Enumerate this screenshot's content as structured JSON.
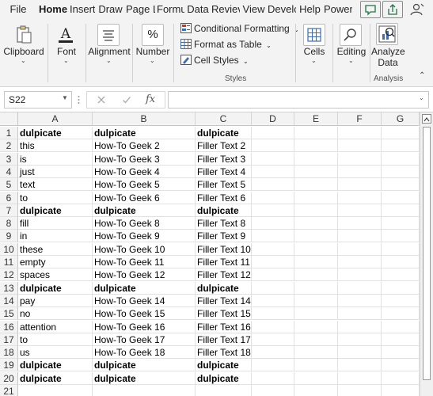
{
  "tabs": [
    "File",
    "Home",
    "Insert",
    "Draw",
    "Page L",
    "Formu",
    "Data",
    "Reviev",
    "View",
    "Develc",
    "Help",
    "Power"
  ],
  "active_tab": "Home",
  "ribbon": {
    "clipboard": "Clipboard",
    "font": "Font",
    "alignment": "Alignment",
    "number": "Number",
    "conditional_formatting": "Conditional Formatting",
    "format_as_table": "Format as Table",
    "cell_styles": "Cell Styles",
    "styles_group": "Styles",
    "cells": "Cells",
    "editing": "Editing",
    "analyze_line1": "Analyze",
    "analyze_line2": "Data",
    "analysis_group": "Analysis",
    "percent_glyph": "%",
    "font_glyph": "A"
  },
  "formula_bar": {
    "name_box": "S22",
    "fx": "fx",
    "formula": ""
  },
  "columns": [
    "A",
    "B",
    "C",
    "D",
    "E",
    "F",
    "G"
  ],
  "rows": [
    {
      "n": "1",
      "a": "dulpicate",
      "b": "dulpicate",
      "c": "dulpicate",
      "bold": true
    },
    {
      "n": "2",
      "a": "this",
      "b": "How-To Geek  2",
      "c": "Filler Text 2",
      "bold": false
    },
    {
      "n": "3",
      "a": "is",
      "b": "How-To Geek  3",
      "c": "Filler Text 3",
      "bold": false
    },
    {
      "n": "4",
      "a": "just",
      "b": "How-To Geek  4",
      "c": "Filler Text 4",
      "bold": false
    },
    {
      "n": "5",
      "a": "text",
      "b": "How-To Geek  5",
      "c": "Filler Text 5",
      "bold": false
    },
    {
      "n": "6",
      "a": "to",
      "b": "How-To Geek  6",
      "c": "Filler Text 6",
      "bold": false
    },
    {
      "n": "7",
      "a": "dulpicate",
      "b": "dulpicate",
      "c": "dulpicate",
      "bold": true
    },
    {
      "n": "8",
      "a": "fill",
      "b": "How-To Geek  8",
      "c": "Filler Text 8",
      "bold": false
    },
    {
      "n": "9",
      "a": "in",
      "b": "How-To Geek  9",
      "c": "Filler Text 9",
      "bold": false
    },
    {
      "n": "10",
      "a": "these",
      "b": "How-To Geek  10",
      "c": "Filler Text 10",
      "bold": false
    },
    {
      "n": "11",
      "a": "empty",
      "b": "How-To Geek  11",
      "c": "Filler Text 11",
      "bold": false
    },
    {
      "n": "12",
      "a": "spaces",
      "b": "How-To Geek  12",
      "c": "Filler Text 12",
      "bold": false
    },
    {
      "n": "13",
      "a": "dulpicate",
      "b": "dulpicate",
      "c": "dulpicate",
      "bold": true
    },
    {
      "n": "14",
      "a": "pay",
      "b": "How-To Geek  14",
      "c": "Filler Text 14",
      "bold": false
    },
    {
      "n": "15",
      "a": "no",
      "b": "How-To Geek  15",
      "c": "Filler Text 15",
      "bold": false
    },
    {
      "n": "16",
      "a": "attention",
      "b": "How-To Geek  16",
      "c": "Filler Text 16",
      "bold": false
    },
    {
      "n": "17",
      "a": "to",
      "b": "How-To Geek  17",
      "c": "Filler Text 17",
      "bold": false
    },
    {
      "n": "18",
      "a": "us",
      "b": "How-To Geek  18",
      "c": "Filler Text 18",
      "bold": false
    },
    {
      "n": "19",
      "a": "dulpicate",
      "b": "dulpicate",
      "c": "dulpicate",
      "bold": true
    },
    {
      "n": "20",
      "a": "dulpicate",
      "b": "dulpicate",
      "c": "dulpicate",
      "bold": true
    },
    {
      "n": "21",
      "a": "",
      "b": "",
      "c": "",
      "bold": false
    }
  ],
  "colors": {
    "accent": "#217346",
    "grid_line": "#e1e1e1",
    "header_bg": "#f3f3f3"
  }
}
